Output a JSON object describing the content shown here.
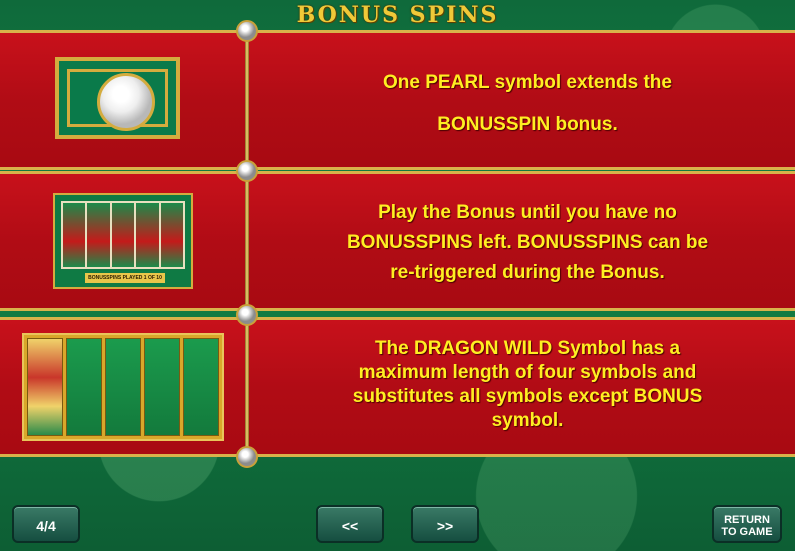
{
  "header": {
    "title": "BONUS SPINS"
  },
  "panels": [
    {
      "text_lines": [
        "One PEARL symbol extends the",
        "BONUSSPIN bonus."
      ],
      "image": "pearl-symbol"
    },
    {
      "text_lines": [
        "Play the Bonus until you have no",
        "BONUSSPINS left. BONUSSPINS can be",
        "re-triggered during the Bonus."
      ],
      "image": "bonus-game-screenshot",
      "mini_label": "BONUSSPINS PLAYED 1 OF 10"
    },
    {
      "text_lines": [
        "The DRAGON WILD Symbol has a",
        "maximum length of four symbols and",
        "substitutes all symbols except BONUS",
        "symbol."
      ],
      "image": "dragon-wild-reels"
    }
  ],
  "footer": {
    "page_indicator": "4/4",
    "prev_label": "<<",
    "next_label": ">>",
    "return_line1": "RETURN",
    "return_line2": "TO GAME"
  },
  "colors": {
    "panel_red": "#b10c15",
    "text_yellow": "#ffee22",
    "gold": "#d9b24a",
    "bg_green": "#138246"
  }
}
